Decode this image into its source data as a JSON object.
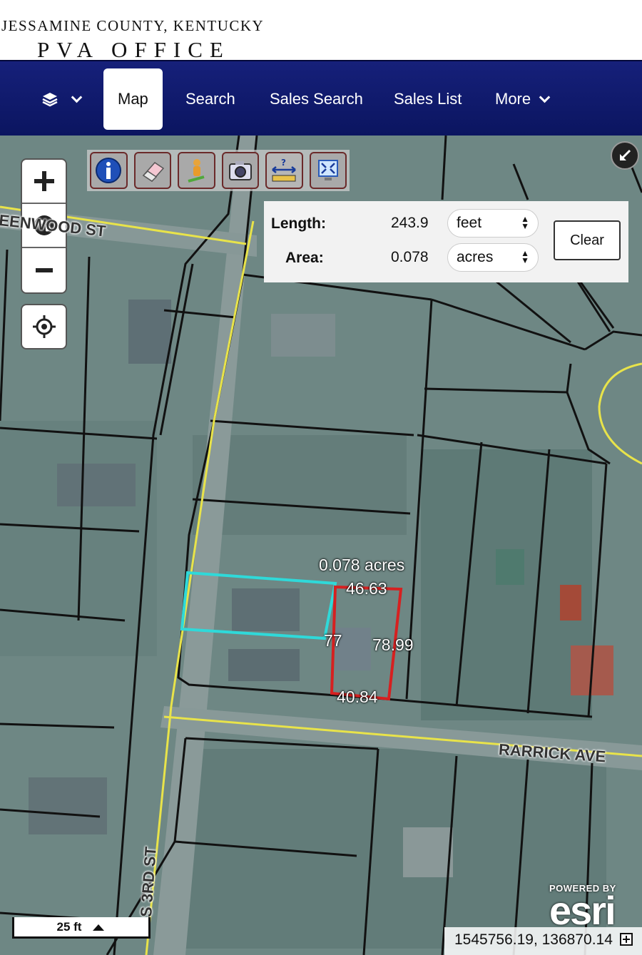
{
  "header": {
    "county": "JESSAMINE COUNTY, KENTUCKY",
    "office": "PVA OFFICE"
  },
  "nav": {
    "items": [
      {
        "label": "Map",
        "active": true
      },
      {
        "label": "Search"
      },
      {
        "label": "Sales Search"
      },
      {
        "label": "Sales List"
      },
      {
        "label": "More"
      }
    ]
  },
  "icons": {
    "layers": "layers-icon",
    "info": "info-icon",
    "eraser": "eraser-icon",
    "street-view": "street-view-icon",
    "camera": "camera-icon",
    "measure": "measure-icon",
    "extent": "full-extent-icon",
    "expand": "expand-icon",
    "globe": "globe-icon",
    "locate": "crosshair-icon"
  },
  "measure": {
    "length_label": "Length:",
    "length_value": "243.9",
    "length_unit": "feet",
    "area_label": "Area:",
    "area_value": "0.078",
    "area_unit": "acres",
    "clear_label": "Clear"
  },
  "map": {
    "labels": {
      "area": "0.078 acres",
      "seg_top": "46.63",
      "seg_right": "78.99",
      "seg_bottom": "40.84",
      "seg_left": "77"
    },
    "streets": {
      "north": "EENWOOD ST",
      "rarrick": "RARRICK AVE",
      "third": "S 3RD ST"
    },
    "scale": "25 ft",
    "coordinates": "1545756.19, 136870.14",
    "esri_powered": "POWERED BY",
    "esri_logo": "esri"
  },
  "colors": {
    "nav_bg": "#0b1560",
    "parcel_line": "#111111",
    "road_line": "#e8e34a",
    "selected_parcel": "#2fd9d9",
    "measure_polygon": "#d62020"
  }
}
